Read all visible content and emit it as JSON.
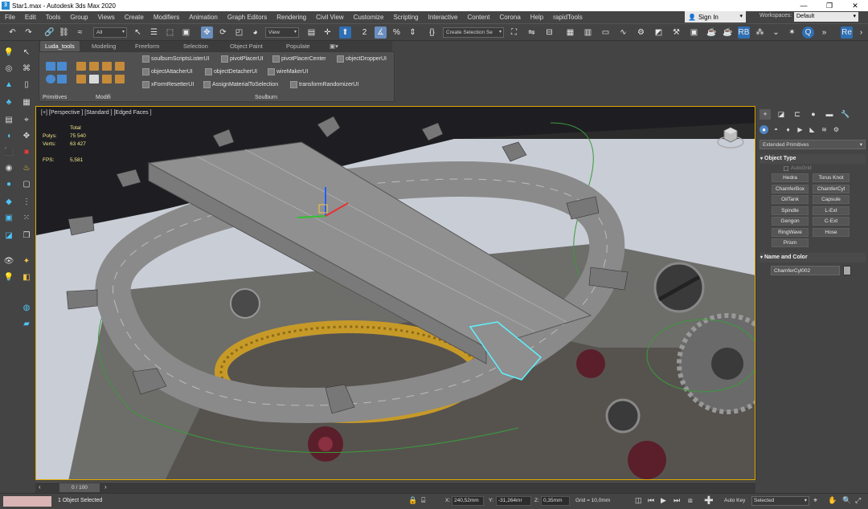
{
  "window": {
    "title": "Star1.max - Autodesk 3ds Max 2020",
    "buttons": [
      "—",
      "❐",
      "✕"
    ]
  },
  "menu": {
    "items": [
      "File",
      "Edit",
      "Tools",
      "Group",
      "Views",
      "Create",
      "Modifiers",
      "Animation",
      "Graph Editors",
      "Rendering",
      "Civil View",
      "Customize",
      "Scripting",
      "Interactive",
      "Content",
      "Corona",
      "Help",
      "rapidTools"
    ],
    "sign_in": "Sign In",
    "workspaces_label": "Workspaces:",
    "workspaces_value": "Default"
  },
  "toolbar": {
    "filter_select": "All",
    "coord_select": "View",
    "named_selection": "Create Selection Se"
  },
  "ribbon": {
    "tabs": [
      "Luda_tools",
      "Modeling",
      "Freeform",
      "Selection",
      "Object Paint",
      "Populate"
    ],
    "groups": {
      "primitives": "Primitives",
      "modifi": "Modifi",
      "soulburn": "Soulburn"
    },
    "soulburn_items": [
      "soulburnScriptsListerUI",
      "pivotPlacerUI",
      "pivotPlacerCenter",
      "objectDropperUI",
      "objectAttacherUI",
      "objectDetacherUI",
      "wireMakerUI",
      "xFormResetterUI",
      "AssignMaterialToSelection",
      "transformRandomizerUI"
    ]
  },
  "viewport": {
    "label": "[+] [Perspective ] [Standard ] [Edged Faces ]",
    "stats": {
      "total_label": "Total",
      "polys_label": "Polys:",
      "polys_value": "75 540",
      "verts_label": "Verts:",
      "verts_value": "63 427",
      "fps_label": "FPS:",
      "fps_value": "5,581"
    }
  },
  "command_panel": {
    "dropdown": "Extended Primitives",
    "object_type_title": "Object Type",
    "autogrid": "AutoGrid",
    "buttons": [
      "Hedra",
      "Torus Knot",
      "ChamferBox",
      "ChamferCyl",
      "OilTank",
      "Capsule",
      "Spindle",
      "L-Ext",
      "Gengon",
      "C-Ext",
      "RingWave",
      "Hose",
      "Prism"
    ],
    "name_color_title": "Name and Color",
    "object_name": "ChamferCyl002",
    "swatch_color": "#a8a8a8"
  },
  "timeline": {
    "slider": "0 / 100"
  },
  "status": {
    "selected_text": "1 Object Selected",
    "x_label": "X:",
    "x_value": "240,52mm",
    "y_label": "Y:",
    "y_value": "-31,264mr",
    "z_label": "Z:",
    "z_value": "0,35mm",
    "grid": "Grid = 10,0mm",
    "auto_key": "Auto Key",
    "selected_dd": "Selected"
  }
}
